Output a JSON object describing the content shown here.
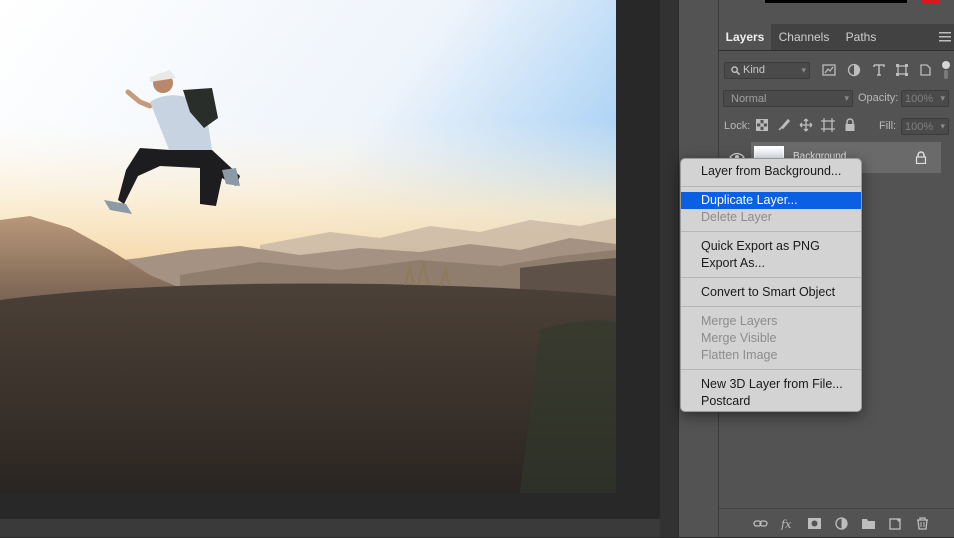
{
  "layers_panel": {
    "tabs": [
      {
        "label": "Layers",
        "active": true
      },
      {
        "label": "Channels",
        "active": false
      },
      {
        "label": "Paths",
        "active": false
      }
    ],
    "filter_kind": "Kind",
    "blend_mode": "Normal",
    "opacity_label": "Opacity:",
    "opacity_value": "100%",
    "lock_label": "Lock:",
    "fill_label": "Fill:",
    "fill_value": "100%",
    "layer": {
      "name": "Background",
      "locked": true,
      "visible": true
    },
    "bottom_icons": [
      "link-icon",
      "fx-icon",
      "mask-icon",
      "adjustment-icon",
      "folder-icon",
      "new-layer-icon",
      "trash-icon"
    ]
  },
  "context_menu": {
    "items": [
      {
        "label": "Layer from Background...",
        "enabled": true
      },
      {
        "label": "Duplicate Layer...",
        "enabled": true,
        "highlighted": true
      },
      {
        "label": "Delete Layer",
        "enabled": false
      },
      {
        "label": "Quick Export as PNG",
        "enabled": true
      },
      {
        "label": "Export As...",
        "enabled": true
      },
      {
        "label": "Convert to Smart Object",
        "enabled": true
      },
      {
        "label": "Merge Layers",
        "enabled": false
      },
      {
        "label": "Merge Visible",
        "enabled": false
      },
      {
        "label": "Flatten Image",
        "enabled": false
      },
      {
        "label": "New 3D Layer from File...",
        "enabled": true
      },
      {
        "label": "Postcard",
        "enabled": true
      }
    ]
  },
  "colors": {
    "menu_highlight": "#0a5fe2",
    "panel_bg": "#535353",
    "foreground_swatch": "#000000",
    "background_swatch": "#e0141e"
  }
}
